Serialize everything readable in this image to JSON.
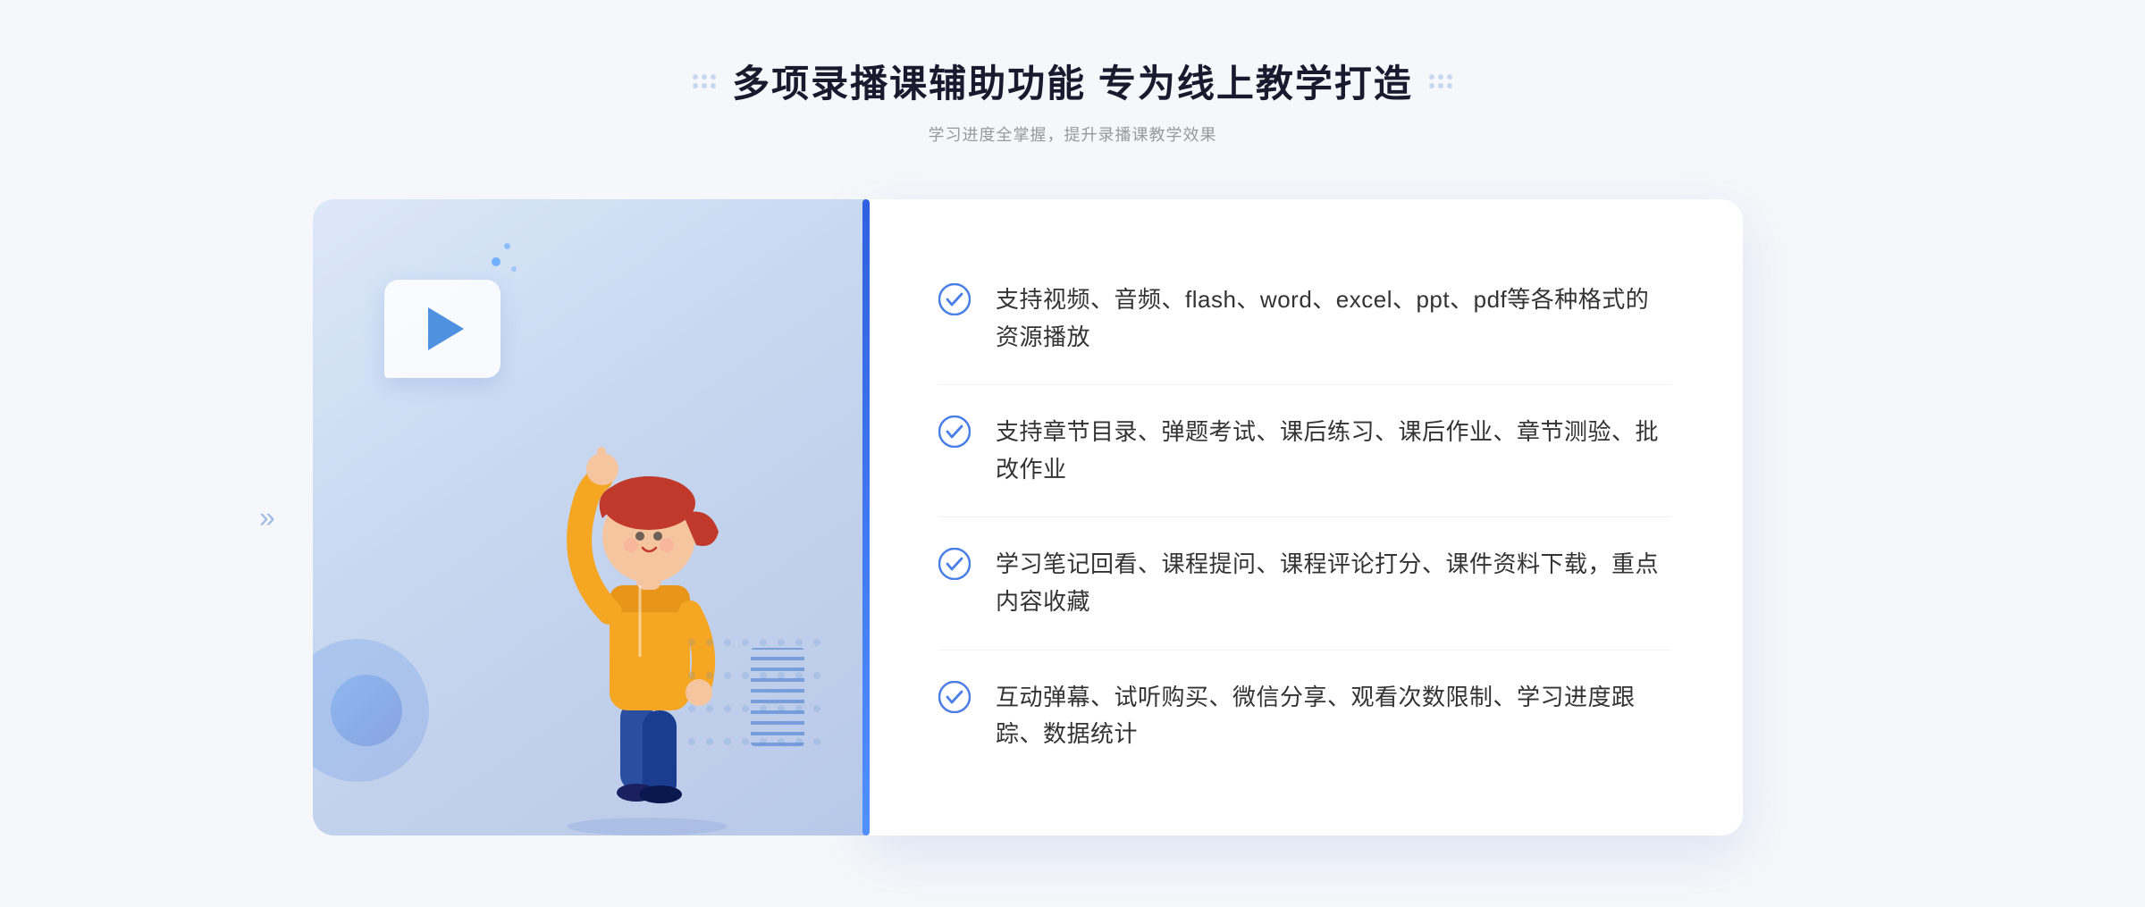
{
  "header": {
    "title": "多项录播课辅助功能 专为线上教学打造",
    "subtitle": "学习进度全掌握，提升录播课教学效果"
  },
  "features": [
    {
      "id": 1,
      "text": "支持视频、音频、flash、word、excel、ppt、pdf等各种格式的资源播放"
    },
    {
      "id": 2,
      "text": "支持章节目录、弹题考试、课后练习、课后作业、章节测验、批改作业"
    },
    {
      "id": 3,
      "text": "学习笔记回看、课程提问、课程评论打分、课件资料下载，重点内容收藏"
    },
    {
      "id": 4,
      "text": "互动弹幕、试听购买、微信分享、观看次数限制、学习进度跟踪、数据统计"
    }
  ],
  "icons": {
    "check": "✓",
    "left_arrow": "»",
    "play": "▶"
  },
  "colors": {
    "primary": "#4a7fe8",
    "title": "#1a1a2e",
    "subtitle": "#999999",
    "feature_text": "#333333",
    "check_color": "#4a7fe8",
    "accent": "#3060e0",
    "bg": "#f5f7fa"
  }
}
